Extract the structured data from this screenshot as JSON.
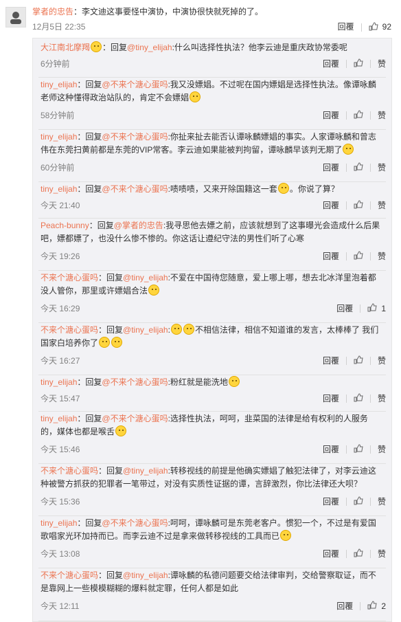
{
  "top_comment": {
    "author": "掌者的忠告",
    "text": "：李文迪这事要怪中演协，中演协很快就死掉的了。",
    "time": "12月5日 22:35",
    "reply_label": "回覆",
    "like_count": "92"
  },
  "replies": [
    {
      "user": "大江南北摩羯",
      "emoji_after_user": true,
      "prefix": "：回复",
      "mention": "@tiny_elijah",
      "text": ":什么叫选择性执法？他李云迪是重庆政协常委呢",
      "tail_emojis": 0,
      "time": "6分钟前",
      "reply_label": "回覆",
      "action2": "赞",
      "like_count": ""
    },
    {
      "user": "tiny_elijah",
      "prefix": "：回复",
      "mention": "@不来个溏心蛋吗",
      "text": ":我又没嫖娼。不过呢在国内嫖娼是选择性执法。像谭咏麟老师这种懂得政治站队的，肯定不会嫖娼",
      "tail_emojis": 1,
      "time": "58分钟前",
      "reply_label": "回覆",
      "action2": "赞",
      "like_count": ""
    },
    {
      "user": "tiny_elijah",
      "prefix": "：回复",
      "mention": "@不来个溏心蛋吗",
      "text": ":你扯来扯去能否认谭咏麟嫖娼的事实。人家谭咏麟和曾志伟在东莞扫黄前都是东莞的VIP常客。李云迪如果能被判拘留，谭咏麟早该判无期了",
      "tail_emojis": 1,
      "time": "60分钟前",
      "reply_label": "回覆",
      "action2": "赞",
      "like_count": ""
    },
    {
      "user": "tiny_elijah",
      "prefix": "：回复",
      "mention": "@不来个溏心蛋吗",
      "text": ":啧啧啧，又来开除国籍这一套",
      "tail_emojis": 1,
      "text2": "。你说了算？",
      "time": "今天 21:40",
      "reply_label": "回覆",
      "action2": "赞",
      "like_count": ""
    },
    {
      "user": "Peach-bunny",
      "prefix": "：回复",
      "mention": "@掌者的忠告",
      "text": ":我寻思他去嫖之前，应该就想到了这事曝光会造成什么后果吧，嫖都嫖了，也没什么惨不惨的。你这话让遵纪守法的男性们听了心寒",
      "tail_emojis": 0,
      "time": "今天 19:26",
      "reply_label": "回覆",
      "action2": "赞",
      "like_count": ""
    },
    {
      "user": "不来个溏心蛋吗",
      "prefix": "：回复",
      "mention": "@tiny_elijah",
      "text": ":不爱在中国待您随意，爱上哪上哪，想去北冰洋里泡着都没人管你，那里或许嫖娼合法",
      "tail_emojis": 1,
      "time": "今天 16:29",
      "reply_label": "回覆",
      "action2": "赞",
      "like_count": "1"
    },
    {
      "user": "不来个溏心蛋吗",
      "prefix": "：回复",
      "mention": "@tiny_elijah",
      "text": ":",
      "lead_emojis": 2,
      "text2": "不相信法律，相信不知道谁的发言，太棒棒了 我们国家白培养你了",
      "tail_emojis": 2,
      "time": "今天 16:27",
      "reply_label": "回覆",
      "action2": "赞",
      "like_count": ""
    },
    {
      "user": "tiny_elijah",
      "prefix": "：回复",
      "mention": "@不来个溏心蛋吗",
      "text": ":粉红就是能洗地",
      "tail_emojis": 1,
      "time": "今天 15:47",
      "reply_label": "回覆",
      "action2": "赞",
      "like_count": ""
    },
    {
      "user": "tiny_elijah",
      "prefix": "：回复",
      "mention": "@不来个溏心蛋吗",
      "text": ":选择性执法，呵呵，韭菜国的法律是给有权利的人服务的，媒体也都是喉舌",
      "tail_emojis": 1,
      "time": "今天 15:46",
      "reply_label": "回覆",
      "action2": "赞",
      "like_count": ""
    },
    {
      "user": "不来个溏心蛋吗",
      "prefix": "：回复",
      "mention": "@tiny_elijah",
      "text": ":转移视线的前提是他确实嫖娼了触犯法律了，对李云迪这种被警方抓获的犯罪者一笔带过，对没有实质性证据的谭，言辞激烈，你比法律还大呗？",
      "tail_emojis": 0,
      "time": "今天 15:36",
      "reply_label": "回覆",
      "action2": "赞",
      "like_count": ""
    },
    {
      "user": "tiny_elijah",
      "prefix": "：回复",
      "mention": "@不来个溏心蛋吗",
      "text": ":呵呵，谭咏麟可是东莞老客户。惯犯一个，不过是有爱国歌唱家光环加持而已。而李云迪不过是拿来做转移视线的工具而已",
      "tail_emojis": 1,
      "time": "今天 13:08",
      "reply_label": "回覆",
      "action2": "赞",
      "like_count": ""
    },
    {
      "user": "不来个溏心蛋吗",
      "prefix": "：回复",
      "mention": "@tiny_elijah",
      "text": ":谭咏麟的私德问题要交给法律审判，交给警察取证，而不是靠网上一些模模糊糊的爆料就定罪，任何人都是如此",
      "tail_emojis": 0,
      "time": "今天 12:11",
      "reply_label": "回覆",
      "action2": "赞",
      "like_count": "2"
    }
  ],
  "colors": {
    "link": "#eb7350",
    "meta": "#808080",
    "panel": "#f2f2f5"
  }
}
